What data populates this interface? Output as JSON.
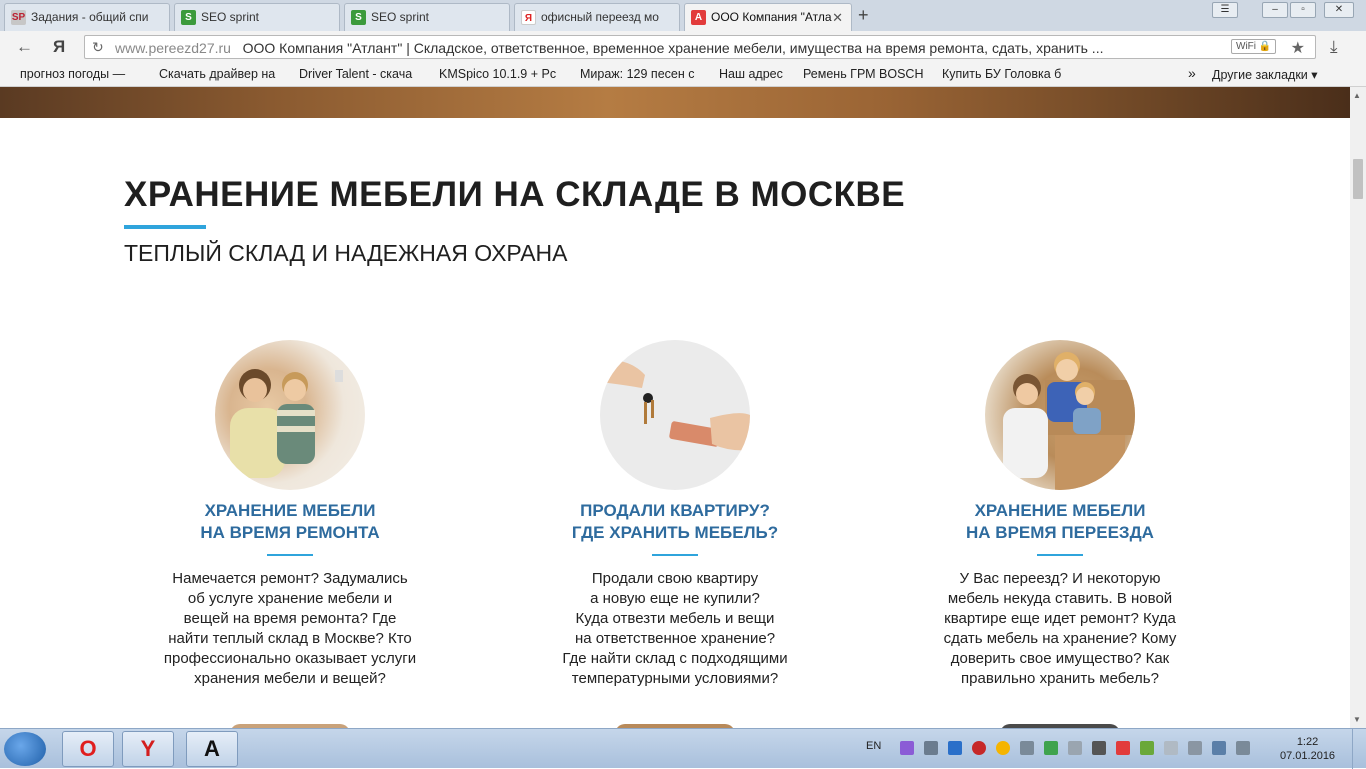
{
  "browser": {
    "tabs": [
      {
        "label": "Задания - общий спи",
        "favicon": "SP",
        "active": false
      },
      {
        "label": "SEO sprint",
        "favicon": "S",
        "active": false
      },
      {
        "label": "SEO sprint",
        "favicon": "S",
        "active": false
      },
      {
        "label": "офисный переезд мо",
        "favicon": "Я",
        "active": false
      },
      {
        "label": "ООО Компания \"Атла",
        "favicon": "A",
        "active": true
      }
    ],
    "new_tab": "+",
    "yandex_logo": "Я",
    "url_domain": "www.pereezd27.ru",
    "url_title": "ООО Компания \"Атлант\" | Складское, ответственное, временное хранение мебели, имущества на время ремонта, сдать, хранить ...",
    "wifi_badge": "WiFi",
    "bookmarks": [
      "прогноз погоды —",
      "Скачать драйвер на",
      "Driver Talent - скача",
      "KMSpico 10.1.9 + Рс",
      "Мираж: 129 песен с",
      "Наш адрес",
      "Ремень ГРМ BOSCH",
      "Купить БУ Головка б"
    ],
    "bookmarks_more": "»",
    "other_bookmarks": "Другие закладки"
  },
  "page": {
    "title": "ХРАНЕНИЕ МЕБЕЛИ НА СКЛАДЕ В МОСКВЕ",
    "subtitle": "ТЕПЛЫЙ СКЛАД И НАДЕЖНАЯ ОХРАНА",
    "cards": [
      {
        "title_line1": "ХРАНЕНИЕ МЕБЕЛИ",
        "title_line2": "НА ВРЕМЯ РЕМОНТА",
        "text": [
          "Намечается ремонт? Задумались",
          "об услуге хранение мебели и",
          "вещей на время ремонта? Где",
          "найти теплый склад в Москве? Кто",
          "профессионально оказывает услуги",
          "хранения мебели и вещей?"
        ]
      },
      {
        "title_line1": "ПРОДАЛИ КВАРТИРУ?",
        "title_line2": "ГДЕ ХРАНИТЬ МЕБЕЛЬ?",
        "text": [
          "Продали свою квартиру",
          "а новую еще не купили?",
          "Куда отвезти мебель и вещи",
          "на ответственное хранение?",
          "Где найти склад с подходящими",
          "температурными условиями?"
        ]
      },
      {
        "title_line1": "ХРАНЕНИЕ МЕБЕЛИ",
        "title_line2": "НА ВРЕМЯ ПЕРЕЕЗДА",
        "text": [
          "У Вас переезд? И некоторую",
          "мебель некуда ставить. В новой",
          "квартире еще идет ремонт? Куда",
          "сдать мебель на хранение? Кому",
          "доверить свое имущество? Как",
          "правильно хранить мебель?"
        ]
      }
    ]
  },
  "taskbar": {
    "apps": [
      {
        "icon": "opera-icon",
        "glyph": "O"
      },
      {
        "icon": "yandex-browser-icon",
        "glyph": "Y"
      },
      {
        "icon": "atlant-app-icon",
        "glyph": "A"
      }
    ],
    "lang": "EN",
    "time": "1:22",
    "date": "07.01.2016"
  },
  "colors": {
    "accent_blue": "#2fa4dc",
    "card_title": "#2e6b9e"
  }
}
